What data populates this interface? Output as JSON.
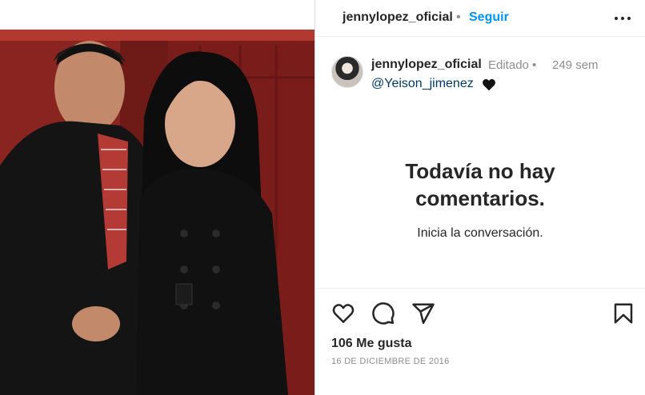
{
  "header": {
    "username": "jennylopez_oficial",
    "separator": "•",
    "follow_label": "Seguir",
    "more_icon": "more-horizontal-icon"
  },
  "caption": {
    "username": "jennylopez_oficial",
    "edited": "Editado •",
    "time": "249 sem",
    "mention": "@Yeison_jimenez",
    "emoji_icon": "black-heart-icon"
  },
  "comments": {
    "empty_title_line1": "Todavía no hay",
    "empty_title_line2": "comentarios.",
    "empty_subtitle": "Inicia la conversación."
  },
  "actions": {
    "like_icon": "heart-outline-icon",
    "comment_icon": "comment-icon",
    "share_icon": "send-icon",
    "save_icon": "bookmark-icon"
  },
  "likes": "106 Me gusta",
  "date": "16 DE DICIEMBRE DE 2016",
  "colors": {
    "accent": "#0095f6",
    "mention": "#00376b",
    "muted": "#8e8e8e"
  }
}
